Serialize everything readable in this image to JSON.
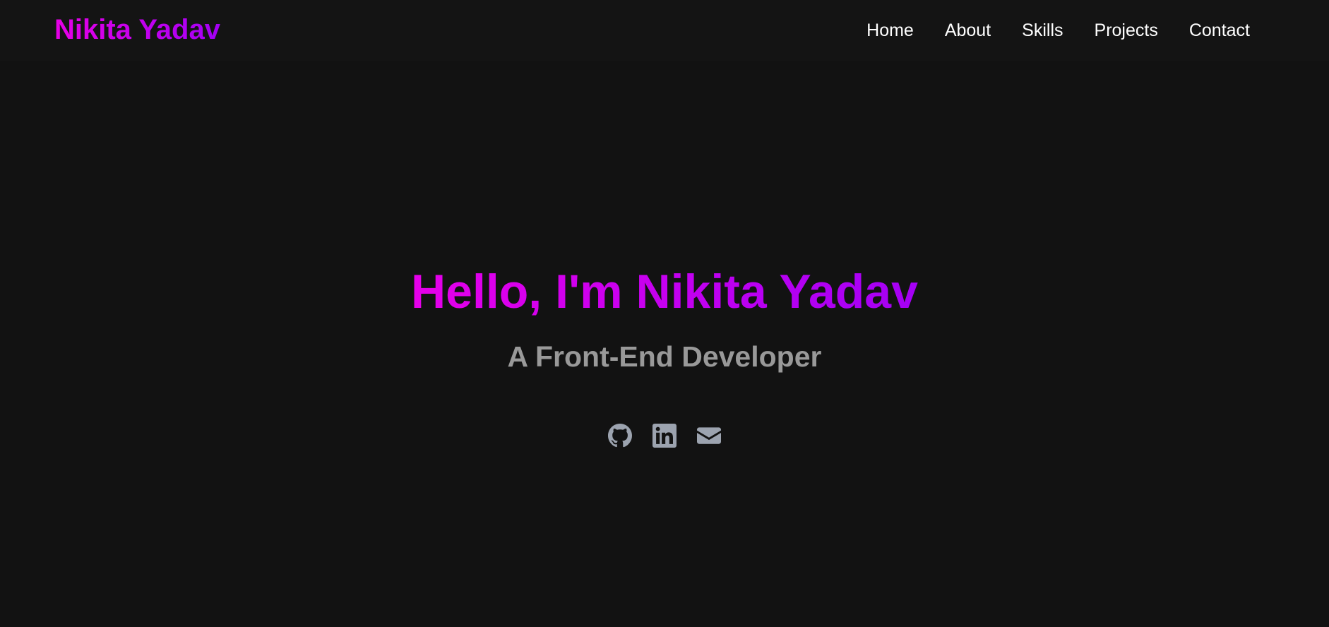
{
  "navbar": {
    "brand": "Nikita Yadav",
    "links": [
      "Home",
      "About",
      "Skills",
      "Projects",
      "Contact"
    ]
  },
  "hero": {
    "title": "Hello, I'm Nikita Yadav",
    "subtitle": "A Front-End Developer",
    "social": [
      {
        "icon": "github-icon"
      },
      {
        "icon": "linkedin-icon"
      },
      {
        "icon": "email-icon"
      }
    ]
  },
  "colors": {
    "background": "#121212",
    "navbar_background": "#141414",
    "accent_start": "#e600e6",
    "accent_end": "#a400f5",
    "subtitle": "#999999",
    "icons": "#9ca3af"
  }
}
